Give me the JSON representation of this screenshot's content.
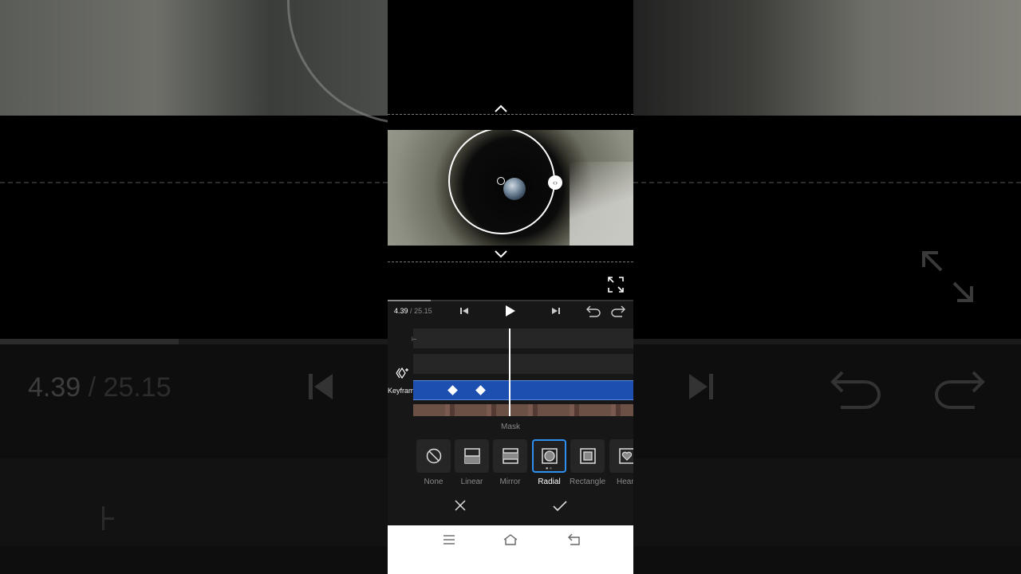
{
  "background": {
    "time_current": "4.39",
    "time_separator": "/",
    "time_total": "25.15"
  },
  "preview": {
    "expand_icon": "expand-icon",
    "collapse_up_icon": "chevron-up-icon",
    "collapse_down_icon": "chevron-down-icon"
  },
  "player": {
    "time_current": "4.39",
    "time_separator": "/",
    "time_total": "25.15",
    "progress_fraction": 0.175
  },
  "timeline": {
    "keyframe_label": "Keyframe",
    "keyframe_positions_seconds": [
      3.6,
      4.3
    ]
  },
  "mask": {
    "title": "Mask",
    "selected": "Radial",
    "options": [
      {
        "label": "None",
        "icon": "none-icon"
      },
      {
        "label": "Linear",
        "icon": "linear-icon"
      },
      {
        "label": "Mirror",
        "icon": "mirror-icon"
      },
      {
        "label": "Radial",
        "icon": "radial-icon"
      },
      {
        "label": "Rectangle",
        "icon": "rectangle-icon"
      },
      {
        "label": "Heart",
        "icon": "heart-icon"
      }
    ]
  },
  "colors": {
    "accent": "#2f8ff0",
    "track_selected": "#1d4fb0",
    "panel": "#171717"
  }
}
